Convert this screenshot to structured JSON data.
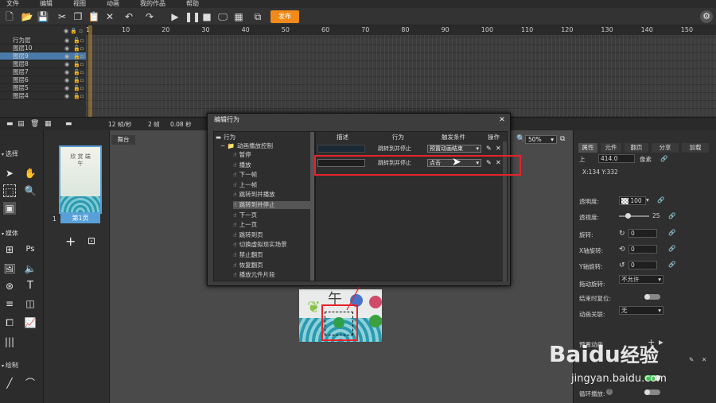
{
  "menu": [
    "文件",
    "编辑",
    "视图",
    "动画",
    "我的作品",
    "帮助"
  ],
  "toolbar": {
    "publish": "发布"
  },
  "timeline": {
    "layers": [
      "行为层",
      "图层10",
      "图层9",
      "图层8",
      "图层7",
      "图层6",
      "图层5",
      "图层4"
    ],
    "selected_index": 2,
    "ruler": [
      "1",
      "10",
      "20",
      "30",
      "40",
      "50",
      "60",
      "70",
      "80",
      "90",
      "100",
      "110",
      "120",
      "130",
      "140",
      "150"
    ],
    "footer": {
      "fps": "12 帧/秒",
      "frame": "2 帧",
      "time": "0.08 秒"
    }
  },
  "tools": {
    "select_section": "选择",
    "media_section": "媒体",
    "draw_section": "绘制"
  },
  "pages": {
    "page_label": "第1页",
    "page_number": "1",
    "thumb_text": "欣 赏 端 午"
  },
  "stage": {
    "tab": "舞台",
    "zoom": "50%",
    "canvas_text": "午"
  },
  "dialog": {
    "title": "编辑行为",
    "tree_root": "行为",
    "tree_group": "动画播放控制",
    "tree_items": [
      "暂停",
      "播放",
      "下一帧",
      "上一帧",
      "跳转到并播放",
      "跳转到并停止",
      "下一页",
      "上一页",
      "跳转到页",
      "切换虚拟现实场景",
      "禁止翻页",
      "恢复翻页",
      "播放元件片段"
    ],
    "selected_item": "跳转到并停止",
    "columns": {
      "desc": "描述",
      "behavior": "行为",
      "trigger": "触发条件",
      "action": "操作"
    },
    "rows": [
      {
        "behavior": "跳转到并停止",
        "trigger": "预置动画结束"
      },
      {
        "behavior": "跳转到并停止",
        "trigger": "点击"
      }
    ]
  },
  "right_panel": {
    "tabs": [
      "属性",
      "元件",
      "翻页",
      "分享",
      "加载"
    ],
    "top": {
      "label": "上",
      "value": "414.0",
      "unit": "像素"
    },
    "coords": "X:134   Y:332",
    "opacity": {
      "label": "透明度:",
      "value": "100"
    },
    "blur": {
      "label": "透视度:",
      "value": "25"
    },
    "rotate": {
      "label": "旋转:",
      "value": "0"
    },
    "x_rotate": {
      "label": "X轴旋转:",
      "value": "0"
    },
    "y_rotate": {
      "label": "Y轴旋转:",
      "value": "0"
    },
    "drag_rotate": {
      "label": "拖动旋转:",
      "value": "不允许"
    },
    "end_reset": {
      "label": "结束时复位:"
    },
    "anim_link": {
      "label": "动画关联:",
      "value": "无"
    },
    "preset": {
      "label": "预置动画"
    },
    "loop": {
      "label": "循环播放:"
    }
  },
  "watermark": {
    "brand": "Baidu",
    "brand_cn": "经验",
    "url": "jingyan.baidu.com"
  }
}
